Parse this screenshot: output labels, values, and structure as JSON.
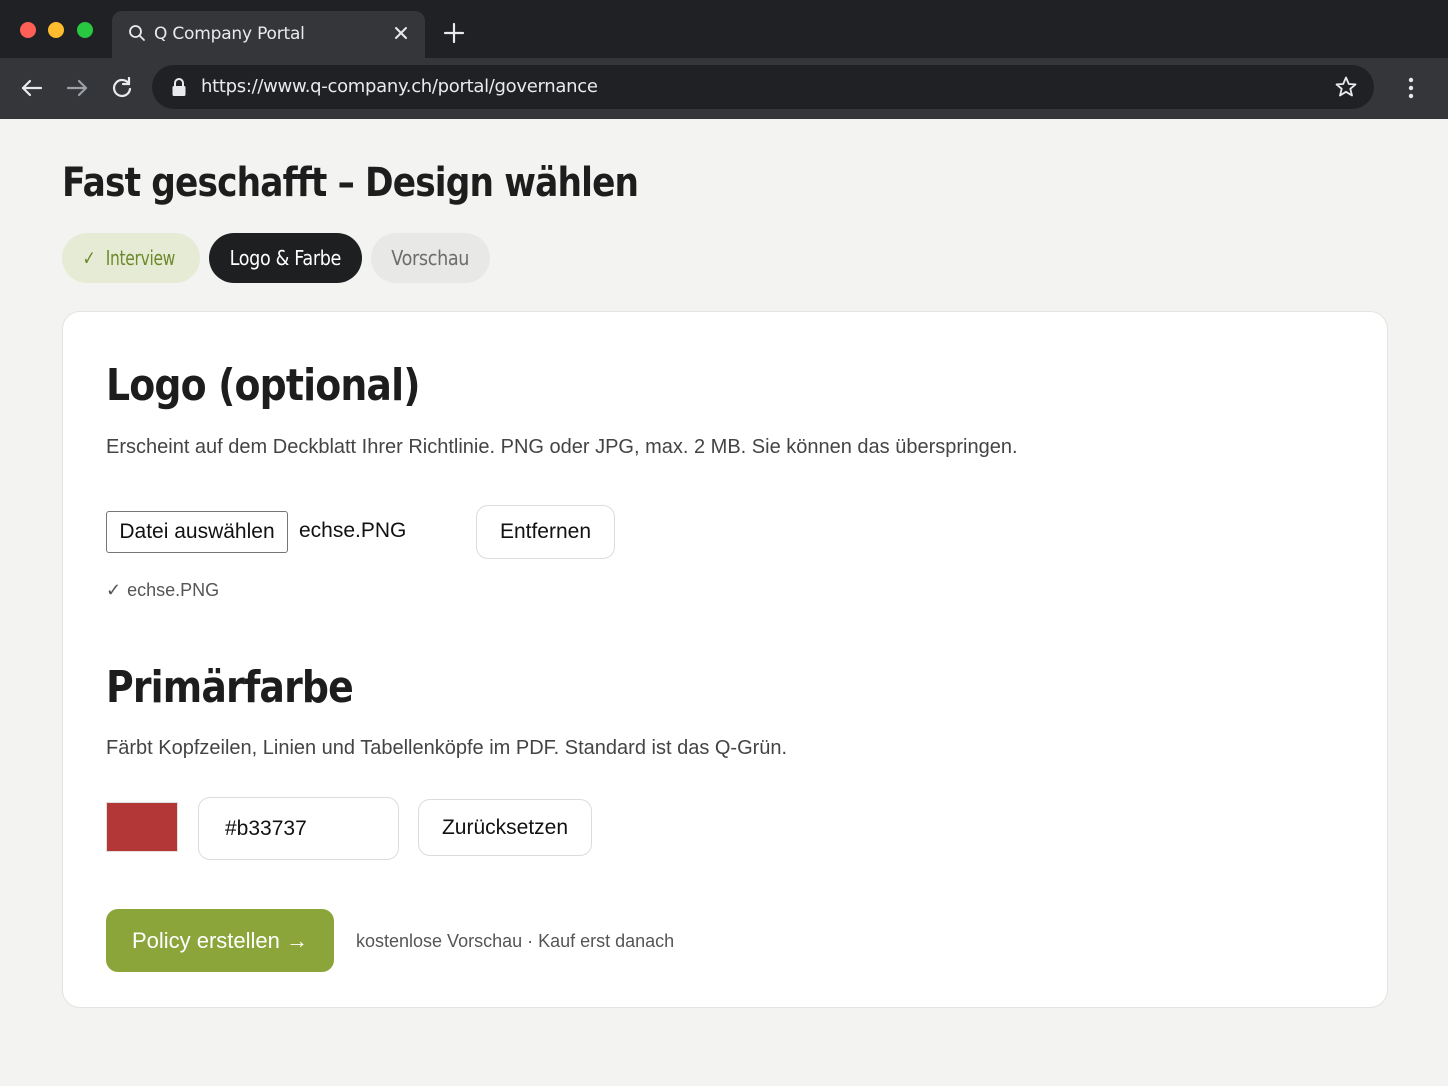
{
  "browser": {
    "tab_title": "Q Company Portal",
    "url": "https://www.q-company.ch/portal/governance"
  },
  "page": {
    "title": "Fast geschafft – Design wählen"
  },
  "steps": [
    {
      "label": "Interview",
      "state": "done",
      "check": "✓"
    },
    {
      "label": "Logo & Farbe",
      "state": "active"
    },
    {
      "label": "Vorschau",
      "state": "upcoming"
    }
  ],
  "logo_section": {
    "heading": "Logo (optional)",
    "description": "Erscheint auf dem Deckblatt Ihrer Richtlinie. PNG oder JPG, max. 2 MB. Sie können das überspringen.",
    "choose_file_label": "Datei auswählen",
    "file_name": "echse.PNG",
    "remove_label": "Entfernen",
    "uploaded_check": "✓",
    "uploaded_file": "echse.PNG"
  },
  "color_section": {
    "heading": "Primärfarbe",
    "description": "Färbt Kopfzeilen, Linien und Tabellenköpfe im PDF. Standard ist das Q-Grün.",
    "hex_value": "#b33737",
    "swatch_color": "#b33737",
    "reset_label": "Zurücksetzen"
  },
  "actions": {
    "create_label": "Policy erstellen →",
    "note": "kostenlose Vorschau · Kauf erst danach",
    "accent_color": "#8ba53b"
  }
}
